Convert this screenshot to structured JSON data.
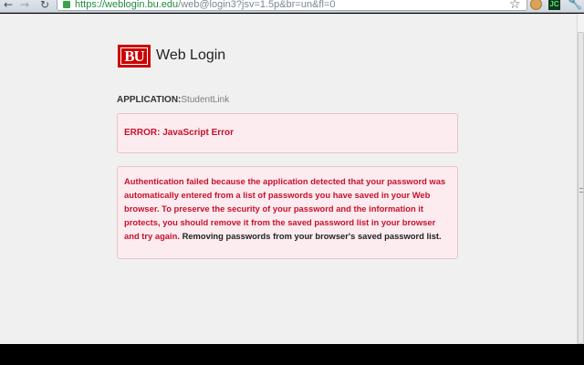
{
  "browser": {
    "url_host": "https://weblogin.bu.edu",
    "url_path": "/web@login3?jsv=1.5p&br=un&fl=0",
    "toolbar_icons": [
      "back-arrow-icon",
      "forward-arrow-icon",
      "reload-icon",
      "lock-icon",
      "star-icon",
      "cookie-extension-icon",
      "jc-extension-icon",
      "wrench-icon"
    ],
    "ext_jc_label": "JC"
  },
  "header": {
    "logo_text": "BU",
    "title": "Web Login",
    "brand_color": "#cc0000"
  },
  "application": {
    "label": "APPLICATION:",
    "value": "StudentLink"
  },
  "error": {
    "text": "ERROR: JavaScript Error",
    "color": "#c8102e"
  },
  "message": {
    "body": "Authentication failed because the application detected that your password was automatically entered from a list of passwords you have saved in your Web browser. To preserve the security of your password and the information it protects, you should remove it from the saved password list in your browser and try again.",
    "link": "Removing passwords from your browser's saved password list."
  }
}
